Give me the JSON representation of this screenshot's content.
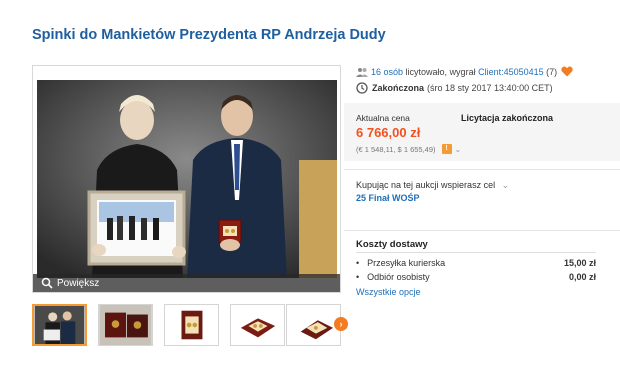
{
  "title": "Spinki do Mankietów Prezydenta RP Andrzeja Dudy",
  "gallery": {
    "zoom_label": "Powiększ"
  },
  "bidders": {
    "count_link": "16 osób",
    "text": "licytowało, wygrał",
    "winner": "Client:45050415",
    "rating": "(7)"
  },
  "ended": {
    "status": "Zakończona",
    "date": "(śro 18 sty 2017 13:40:00 CET)"
  },
  "price": {
    "label": "Aktualna cena",
    "auction_status": "Licytacja zakończona",
    "value": "6 766,00 zł",
    "conversion": "(€ 1 548,11, $ 1 655,49)",
    "warning_icon": "!"
  },
  "support": {
    "text": "Kupując na tej aukcji wspierasz cel",
    "cause": "25 Finał WOŚP"
  },
  "shipping": {
    "title": "Koszty dostawy",
    "rows": [
      {
        "name": "Przesyłka kurierska",
        "value": "15,00 zł"
      },
      {
        "name": "Odbiór osobisty",
        "value": "0,00 zł"
      }
    ],
    "all_options": "Wszystkie opcje"
  },
  "colors": {
    "title_blue": "#1f5f9f",
    "link_blue": "#1f6fb8",
    "price_orange": "#f4511e",
    "accent_orange": "#f47b20"
  }
}
